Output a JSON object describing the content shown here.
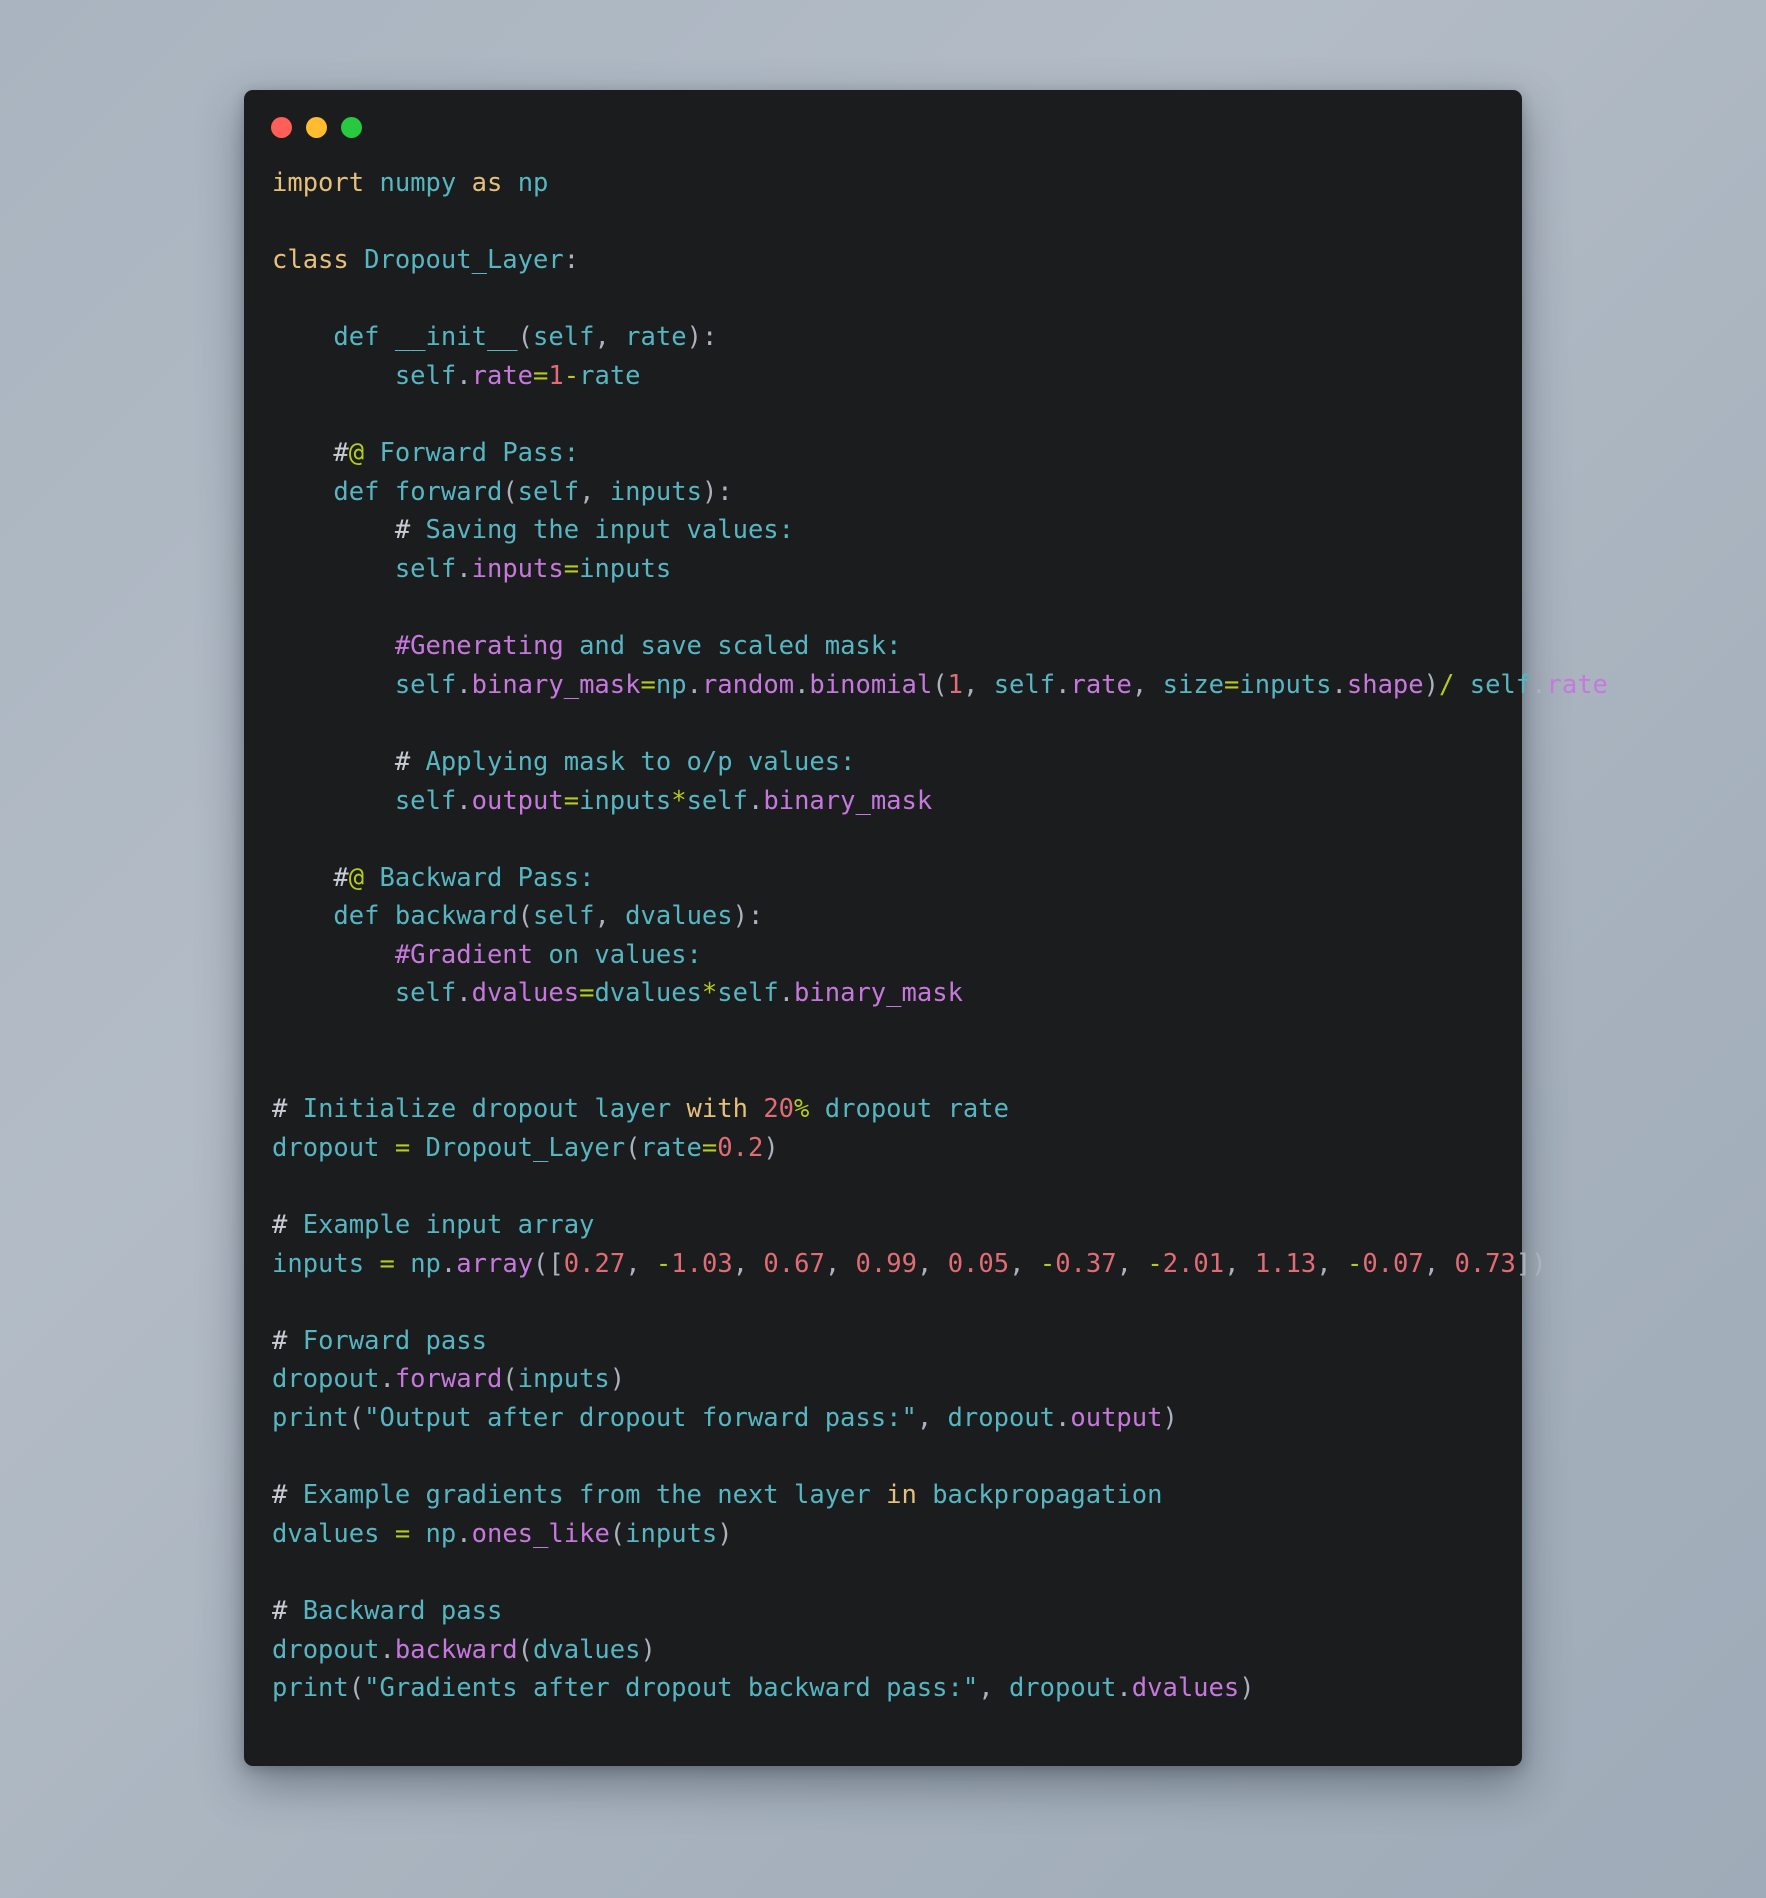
{
  "window": {
    "title": "",
    "traffic_lights": [
      {
        "name": "close",
        "color": "#ff5f57"
      },
      {
        "name": "minimize",
        "color": "#febc2e"
      },
      {
        "name": "maximize",
        "color": "#28c840"
      }
    ],
    "background_color": "#1b1c1d",
    "page_background": "#a9b4c0"
  },
  "theme": {
    "keyword": "#e5c07b",
    "identifier": "#56b6c2",
    "attribute": "#c678dd",
    "number": "#e06c75",
    "operator": "#b5cc18",
    "string": "#56b6c2",
    "comment": "#56b6c2",
    "comment_hash": "#c8ccd4",
    "punctuation": "#abb2bf",
    "language": "python"
  },
  "code": {
    "language": "python",
    "full_text": "import numpy as np\n\nclass Dropout_Layer:\n\n    def __init__(self, rate):\n        self.rate=1-rate\n\n    #@ Forward Pass:\n    def forward(self, inputs):\n        # Saving the input values:\n        self.inputs=inputs\n\n        #Generating and save scaled mask:\n        self.binary_mask=np.random.binomial(1, self.rate, size=inputs.shape)/ self.rate\n\n        # Applying mask to o/p values:\n        self.output=inputs*self.binary_mask\n\n    #@ Backward Pass:\n    def backward(self, dvalues):\n        #Gradient on values:\n        self.dvalues=dvalues*self.binary_mask\n\n\n# Initialize dropout layer with 20% dropout rate\ndropout = Dropout_Layer(rate=0.2)\n\n# Example input array\ninputs = np.array([0.27, -1.03, 0.67, 0.99, 0.05, -0.37, -2.01, 1.13, -0.07, 0.73])\n\n# Forward pass\ndropout.forward(inputs)\nprint(\"Output after dropout forward pass:\", dropout.output)\n\n# Example gradients from the next layer in backpropagation\ndvalues = np.ones_like(inputs)\n\n# Backward pass\ndropout.backward(dvalues)\nprint(\"Gradients after dropout backward pass:\", dropout.dvalues)",
    "lines": [
      "import numpy as np",
      "",
      "class Dropout_Layer:",
      "",
      "    def __init__(self, rate):",
      "        self.rate=1-rate",
      "",
      "    #@ Forward Pass:",
      "    def forward(self, inputs):",
      "        # Saving the input values:",
      "        self.inputs=inputs",
      "",
      "        #Generating and save scaled mask:",
      "        self.binary_mask=np.random.binomial(1, self.rate, size=inputs.shape)/ self.rate",
      "",
      "        # Applying mask to o/p values:",
      "        self.output=inputs*self.binary_mask",
      "",
      "    #@ Backward Pass:",
      "    def backward(self, dvalues):",
      "        #Gradient on values:",
      "        self.dvalues=dvalues*self.binary_mask",
      "",
      "",
      "# Initialize dropout layer with 20% dropout rate",
      "dropout = Dropout_Layer(rate=0.2)",
      "",
      "# Example input array",
      "inputs = np.array([0.27, -1.03, 0.67, 0.99, 0.05, -0.37, -2.01, 1.13, -0.07, 0.73])",
      "",
      "# Forward pass",
      "dropout.forward(inputs)",
      "print(\"Output after dropout forward pass:\", dropout.output)",
      "",
      "# Example gradients from the next layer in backpropagation",
      "dvalues = np.ones_like(inputs)",
      "",
      "# Backward pass",
      "dropout.backward(dvalues)",
      "print(\"Gradients after dropout backward pass:\", dropout.dvalues)"
    ],
    "input_array_values": [
      0.27,
      -1.03,
      0.67,
      0.99,
      0.05,
      -0.37,
      -2.01,
      1.13,
      -0.07,
      0.73
    ],
    "dropout_rate": 0.2,
    "dropout_rate_percent": "20%",
    "class_name": "Dropout_Layer",
    "strings": [
      "Output after dropout forward pass:",
      "Gradients after dropout backward pass:"
    ],
    "comments": [
      "#@ Forward Pass:",
      "# Saving the input values:",
      "#Generating and save scaled mask:",
      "# Applying mask to o/p values:",
      "#@ Backward Pass:",
      "#Gradient on values:",
      "# Initialize dropout layer with 20% dropout rate",
      "# Example input array",
      "# Forward pass",
      "# Example gradients from the next layer in backpropagation",
      "# Backward pass"
    ]
  }
}
